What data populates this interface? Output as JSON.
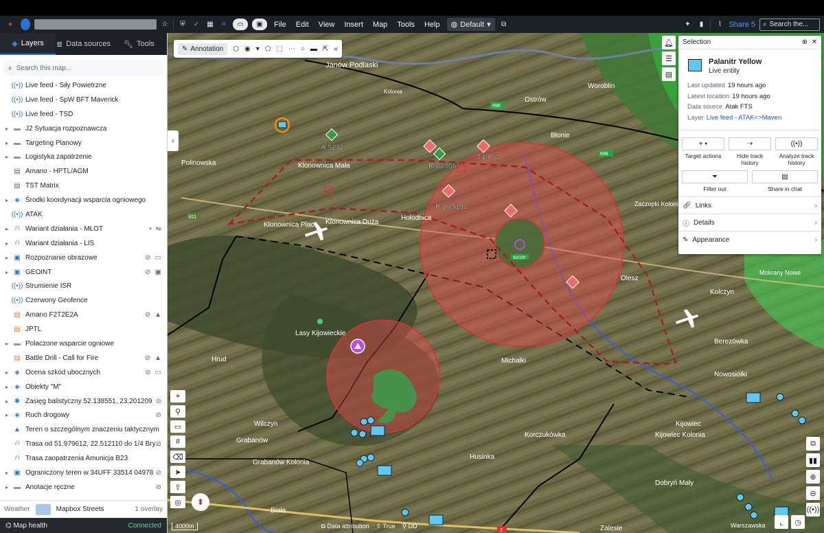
{
  "topbar": {
    "menus": [
      "File",
      "Edit",
      "View",
      "Insert",
      "Map",
      "Tools",
      "Help"
    ],
    "workspace": "Default",
    "share": "Share 5",
    "search_placeholder": "Search the..."
  },
  "left_panel": {
    "tabs": [
      {
        "label": "Layers",
        "icon": "layers-icon"
      },
      {
        "label": "Data sources",
        "icon": "database-icon"
      },
      {
        "label": "Tools",
        "icon": "wrench-icon"
      }
    ],
    "search_placeholder": "Search this map...",
    "layers": [
      {
        "label": "Live feed - Siły Powietrzne",
        "type": "live"
      },
      {
        "label": "Live feed - SpW BFT Maverick",
        "type": "live"
      },
      {
        "label": "Live feed - TSD",
        "type": "live"
      },
      {
        "label": "J2 Sytuacja rozpoznawcza",
        "type": "folder",
        "caret": true
      },
      {
        "label": "Targeting Planowy",
        "type": "folder",
        "caret": true
      },
      {
        "label": "Logistyka zapatrzenie",
        "type": "folder",
        "caret": true
      },
      {
        "label": "Amano - HPTL/AGM",
        "type": "doc"
      },
      {
        "label": "TST Matrix",
        "type": "doc"
      },
      {
        "label": "Środki koordynacji wsparcia ogniowego",
        "type": "globe",
        "caret": true
      },
      {
        "label": "ATAK",
        "type": "live"
      },
      {
        "label": "Wariant działania - MŁOT",
        "type": "route",
        "caret": true
      },
      {
        "label": "Wariant działania - LIS",
        "type": "route",
        "caret": true
      },
      {
        "label": "Rozpoznanie obrazowe",
        "type": "image",
        "caret": true
      },
      {
        "label": "GEOINT",
        "type": "image",
        "caret": true
      },
      {
        "label": "Strumienie ISR",
        "type": "live"
      },
      {
        "label": "Czerwony Geofence",
        "type": "live"
      },
      {
        "label": "Amano F2T2E2A",
        "type": "doc-orange"
      },
      {
        "label": "JPTL",
        "type": "doc-orange"
      },
      {
        "label": "Polaczone wsparcie ogniowe",
        "type": "folder",
        "caret": true
      },
      {
        "label": "Battle Drill - Call for Fire",
        "type": "doc-orange"
      },
      {
        "label": "Ocena szkód ubocznych",
        "type": "globe",
        "caret": true
      },
      {
        "label": "Obiekty \"M\"",
        "type": "globe",
        "caret": true
      },
      {
        "label": "Zasięg balistyczny 52.138551, 23.201209",
        "type": "star",
        "caret": true
      },
      {
        "label": "Ruch drogowy",
        "type": "globe",
        "caret": true
      },
      {
        "label": "Teren o szczególnym znaczeniu taktycznym",
        "type": "triangle"
      },
      {
        "label": "Trasa od 51.979612, 22.512110 do 1/4 Bry...",
        "type": "route"
      },
      {
        "label": "Trasa zaopatrzenia Amunicja B23",
        "type": "route"
      },
      {
        "label": "Ograniczony teren w 34UFF 33514 04978",
        "type": "image",
        "caret": true
      },
      {
        "label": "Anotacje ręczne",
        "type": "folder",
        "caret": true
      }
    ],
    "weather": {
      "label": "Weather",
      "basemap": "Mapbox Streets",
      "overlay": "1 overlay"
    },
    "map_health": {
      "label": "Map health",
      "status": "Connected"
    }
  },
  "annotation_bar": {
    "label": "Annotation"
  },
  "map": {
    "labels": [
      {
        "text": "Janów Podlaski"
      },
      {
        "text": "Kolonia"
      },
      {
        "text": "Ostrów"
      },
      {
        "text": "Woroblin"
      },
      {
        "text": "Błonie"
      },
      {
        "text": "Klonownica Mała"
      },
      {
        "text": "Polinowska"
      },
      {
        "text": "Klonownica Plac"
      },
      {
        "text": "Klonownica Duża"
      },
      {
        "text": "Hołodnica"
      },
      {
        "text": "Zaczopki Kolonia"
      },
      {
        "text": "Olesz"
      },
      {
        "text": "Lasy Kijowieckie"
      },
      {
        "text": "Hrud"
      },
      {
        "text": "Kolczyn"
      },
      {
        "text": "Michałki"
      },
      {
        "text": "Berezówka"
      },
      {
        "text": "Nowosiółki"
      },
      {
        "text": "Wilczyn"
      },
      {
        "text": "Grabanów"
      },
      {
        "text": "Grabanów Kolonia"
      },
      {
        "text": "Husinka"
      },
      {
        "text": "Korczukówka"
      },
      {
        "text": "Kijowiec"
      },
      {
        "text": "Kijowiec Kolonia"
      },
      {
        "text": "Dobryń Mały"
      },
      {
        "text": "Biała"
      },
      {
        "text": "Warszawska"
      },
      {
        "text": "Zalesie"
      },
      {
        "text": "Mokrany Nowe"
      }
    ],
    "units": [
      {
        "label": "A.5231",
        "color": "#2f9e44"
      },
      {
        "label": "R.20.556",
        "color": "#ef6b6b"
      },
      {
        "label": "T.19G4",
        "color": "#ef6b6b"
      },
      {
        "label": "R.20.5192",
        "color": "#ef6b6b"
      }
    ],
    "roads": [
      "698",
      "811",
      "698",
      "2"
    ],
    "badge_text": "90/100",
    "bottom": {
      "scale": "4000m",
      "attribution": "Data attribution",
      "north": "True",
      "coords": "DD"
    }
  },
  "selection": {
    "header": "Selection",
    "name": "Palanitr Yellow",
    "type": "Live entity",
    "fields": [
      {
        "k": "Last updated",
        "v": "19 hours ago",
        "link": false
      },
      {
        "k": "Latest location",
        "v": "19 hours ago",
        "link": false
      },
      {
        "k": "Data source",
        "v": "Atak FTS",
        "link": false
      },
      {
        "k": "Layer",
        "v": "Live feed - ATAK<>Maven",
        "link": true
      }
    ],
    "actions": [
      "Target actions",
      "Hide track history",
      "Analyze track history"
    ],
    "actions2": [
      "Filter out",
      "Share in chat"
    ],
    "rows": [
      {
        "label": "Links",
        "icon": "link-icon"
      },
      {
        "label": "Details",
        "icon": "info-icon"
      },
      {
        "label": "Appearance",
        "icon": "edit-icon"
      }
    ]
  }
}
